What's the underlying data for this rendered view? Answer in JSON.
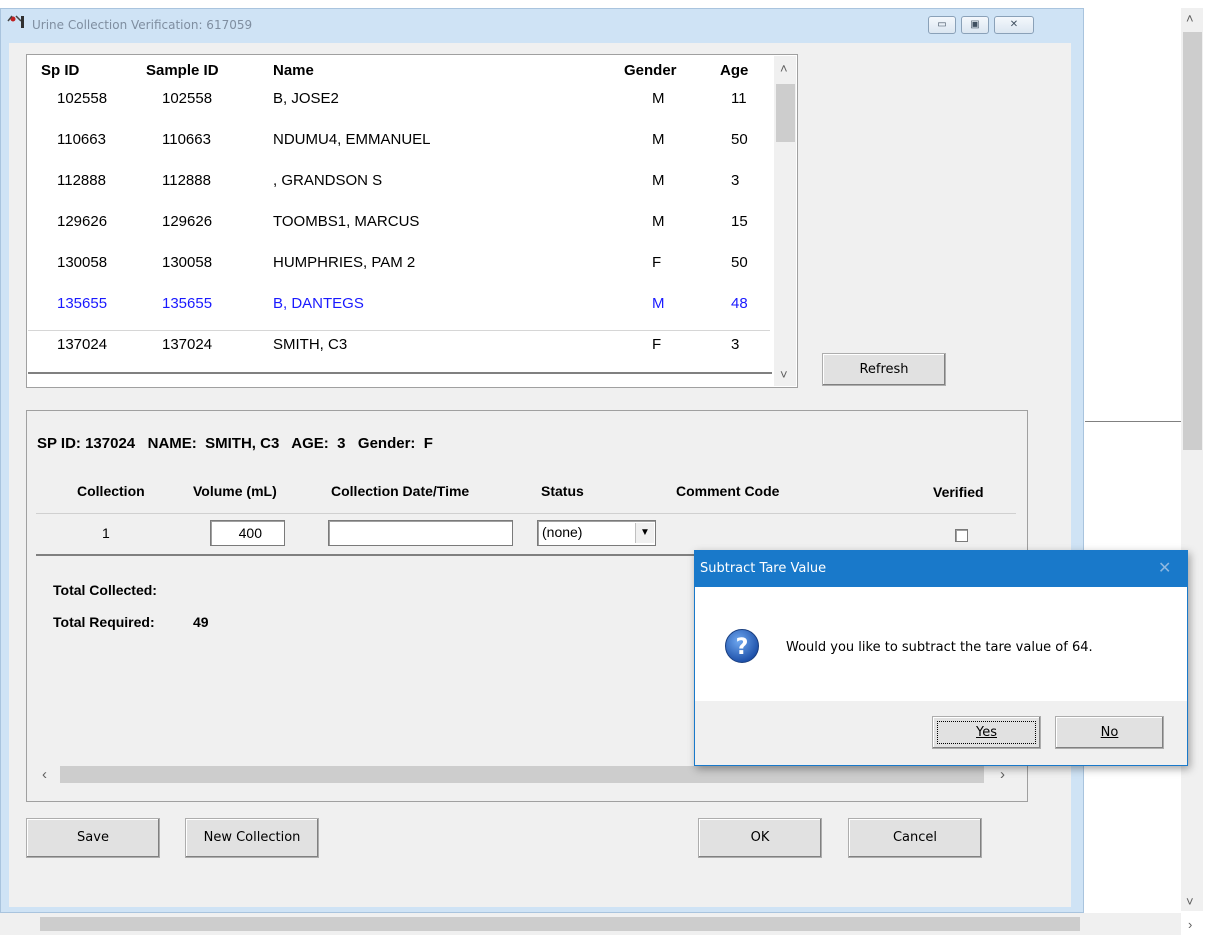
{
  "window": {
    "title": "Urine Collection Verification: 617059",
    "minimize_glyph": "▭",
    "maximize_glyph": "▣",
    "close_glyph": "✕"
  },
  "grid": {
    "headers": [
      "Sp ID",
      "Sample ID",
      "Name",
      "Gender",
      "Age"
    ],
    "rows": [
      {
        "sp_id": "102558",
        "sample_id": "102558",
        "name": "B, JOSE2",
        "gender": "M",
        "age": "11"
      },
      {
        "sp_id": "110663",
        "sample_id": "110663",
        "name": "NDUMU4, EMMANUEL",
        "gender": "M",
        "age": "50"
      },
      {
        "sp_id": "112888",
        "sample_id": "112888",
        "name": ", GRANDSON S",
        "gender": "M",
        "age": "3"
      },
      {
        "sp_id": "129626",
        "sample_id": "129626",
        "name": "TOOMBS1, MARCUS",
        "gender": "M",
        "age": "15"
      },
      {
        "sp_id": "130058",
        "sample_id": "130058",
        "name": "HUMPHRIES, PAM 2",
        "gender": "F",
        "age": "50"
      },
      {
        "sp_id": "135655",
        "sample_id": "135655",
        "name": "B, DANTEGS",
        "gender": "M",
        "age": "48"
      },
      {
        "sp_id": "137024",
        "sample_id": "137024",
        "name": "SMITH, C3",
        "gender": "F",
        "age": "3"
      }
    ],
    "highlight_color": "#1a1aff"
  },
  "buttons": {
    "refresh": "Refresh",
    "save": "Save",
    "new_collection": "New Collection",
    "ok": "OK",
    "cancel": "Cancel"
  },
  "detail": {
    "header": "SP ID: 137024   NAME:  SMITH, C3   AGE:  3   Gender:  F",
    "columns": {
      "collection": "Collection",
      "volume": "Volume (mL)",
      "datetime": "Collection Date/Time",
      "status": "Status",
      "comment": "Comment Code",
      "verified": "Verified"
    },
    "row": {
      "collection": "1",
      "volume": "400",
      "datetime": "",
      "status": "(none)",
      "verified": false
    },
    "total_collected_label": "Total Collected:",
    "total_collected_value": "",
    "total_required_label": "Total Required:",
    "total_required_value": "49"
  },
  "dialog": {
    "title": "Subtract Tare Value",
    "message": "Would you like to subtract the tare value of 64.",
    "yes": "Yes",
    "no": "No",
    "close_glyph": "✕"
  },
  "colors": {
    "dialog_accent": "#1979ca",
    "window_frame": "#cfe3f5"
  }
}
